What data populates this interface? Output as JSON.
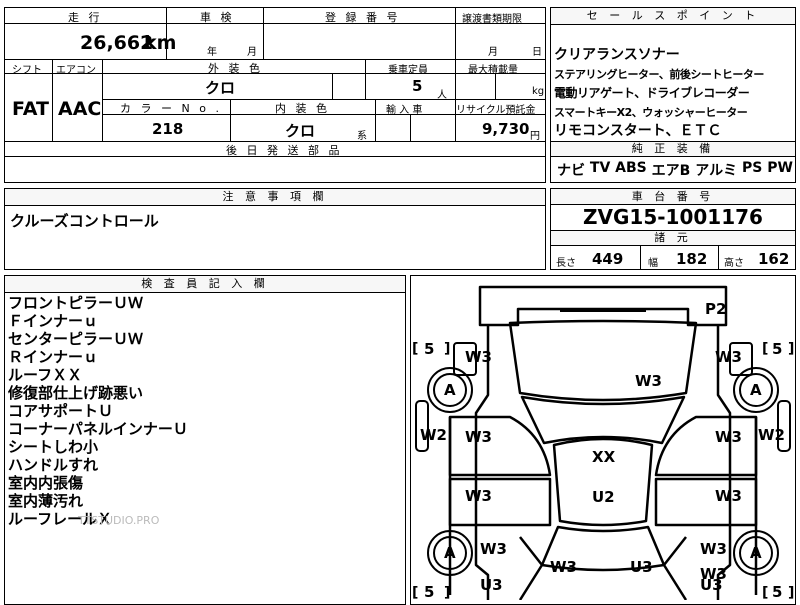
{
  "mileage": {
    "label": "走 行",
    "value": "26,662",
    "unit": "km"
  },
  "inspection": {
    "label": "車 検",
    "year": "年",
    "month": "月"
  },
  "registration": {
    "label": "登 録 番 号",
    "value": ""
  },
  "transfer_deadline": {
    "label": "譲渡書類期限",
    "month": "月",
    "day": "日"
  },
  "shift": {
    "label": "シフト",
    "value": "FAT"
  },
  "aircon": {
    "label": "エアコン",
    "value": "AAC"
  },
  "exterior_color": {
    "label": "外 装 色",
    "value": "クロ"
  },
  "capacity": {
    "label": "乗車定員",
    "value": "5",
    "unit": "人"
  },
  "max_load": {
    "label": "最大積載量",
    "unit": "kg"
  },
  "color_no": {
    "label": "カ ラ ー N o .",
    "value": "218"
  },
  "interior_color": {
    "label": "内 装 色",
    "value": "クロ",
    "suffix": "系"
  },
  "import": {
    "label": "輸 入 車"
  },
  "recycle": {
    "label": "リサイクル預託金",
    "value": "9,730",
    "unit": "円"
  },
  "later_parts": {
    "label": "後 日 発 送 部 品"
  },
  "sales_points": {
    "label": "セ ー ル ス ポ イ ン ト",
    "lines": [
      "クリアランスソナー",
      "ステアリングヒーター、前後シートヒーター",
      "電動リアゲート、ドライブレコーダー",
      "スマートキーX2、ウォッシャーヒーター",
      "リモコンスタート、ＥＴＣ"
    ]
  },
  "equipment": {
    "label": "純 正 装 備",
    "items": [
      "ナビ",
      "TV",
      "ABS",
      "エアB",
      "アルミ",
      "PS",
      "PW"
    ]
  },
  "notes": {
    "label": "注 意 事 項 欄",
    "text": "クルーズコントロール"
  },
  "chassis": {
    "label": "車 台 番 号",
    "value": "ZVG15-1001176"
  },
  "specs": {
    "label": "諸 元",
    "length_label": "長さ",
    "length": "449",
    "width_label": "幅",
    "width": "182",
    "height_label": "高さ",
    "height": "162"
  },
  "inspector": {
    "label": "検 査 員 記 入 欄",
    "lines": [
      "フロントピラーＵＷ",
      "Ｆインナーｕ",
      "センターピラーＵＷ",
      "Ｒインナーｕ",
      "ルーフＸＸ",
      "修復部仕上げ跡悪い",
      "コアサポートＵ",
      "コーナーパネルインナーＵ",
      "シートしわ小",
      "ハンドルすれ",
      "室内内張傷",
      "室内薄汚れ",
      "ルーフレールＸ"
    ],
    "watermark": "TTSTUDIO.PRO"
  },
  "diagram": {
    "marks": {
      "p2": "P2",
      "w3_fl": "W3",
      "w3_fr": "W3",
      "w3_hood": "W3",
      "w3_dl1": "W3",
      "w3_dr1": "W3",
      "w3_dl2": "W3",
      "w3_dr2": "W3",
      "w3_rl": "W3",
      "w3_rr": "W3",
      "w3_trunk": "W3",
      "w3_rrb": "W3",
      "xx": "XX",
      "u2": "U2",
      "u3_l": "U3",
      "u3_c": "U3",
      "u3_r": "U3",
      "w2_l": "W2",
      "w2_r": "W2",
      "a_fl": "A",
      "a_fr": "A",
      "a_rl": "A",
      "a_rr": "A",
      "t_fl": "5",
      "t_fr": "5",
      "t_rl": "5",
      "t_rr": "5"
    }
  }
}
